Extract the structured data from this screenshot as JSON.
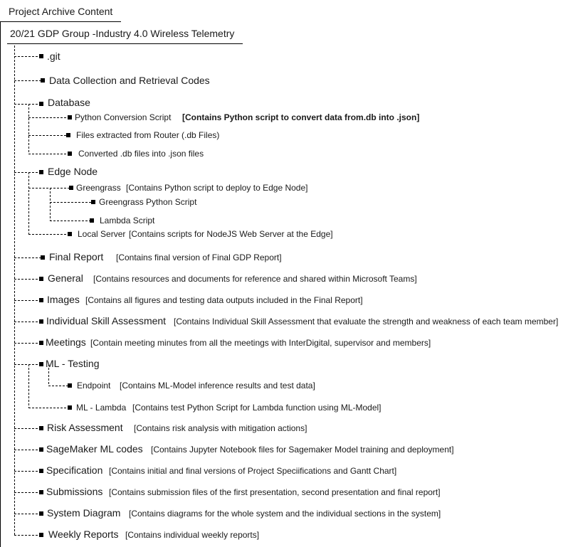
{
  "header": {
    "archive_title": "Project Archive Content",
    "group_title": "20/21 GDP Group  -Industry 4.0 Wireless Telemetry"
  },
  "tree": {
    "git": {
      "label": ".git"
    },
    "data_collection": {
      "label": "Data Collection and Retrieval Codes"
    },
    "database": {
      "label": "Database",
      "python_conversion": {
        "label": "Python Conversion Script",
        "desc": "[Contains Python script to convert  data from.db into .json]"
      },
      "files_extracted": {
        "label": "Files extracted from Router (.db Files)"
      },
      "converted_files": {
        "label": "Converted .db files into .json files"
      }
    },
    "edge_node": {
      "label": "Edge Node",
      "greengrass": {
        "label": "Greengrass",
        "desc": "[Contains Python script to deploy to Edge Node]"
      },
      "greengrass_python": {
        "label": "Greengrass Python Script"
      },
      "lambda_script": {
        "label": "Lambda Script"
      },
      "local_server": {
        "label": "Local Server",
        "desc": "[Contains scripts for NodeJS Web Server at the Edge]"
      }
    },
    "final_report": {
      "label": "Final Report",
      "desc": "[Contains final version of Final GDP Report]"
    },
    "general": {
      "label": "General",
      "desc": "[Contains resources and documents for reference and shared within Microsoft Teams]"
    },
    "images": {
      "label": "Images",
      "desc": "[Contains all figures and testing data outputs included in the Final Report]"
    },
    "skill_assessment": {
      "label": "Individual Skill Assessment",
      "desc": "[Contains Individual Skill Assessment that evaluate the strength and weakness of each team member]"
    },
    "meetings": {
      "label": "Meetings",
      "desc": "[Contain meeting minutes from all the meetings with InterDigital, supervisor and members]"
    },
    "ml_testing": {
      "label": "ML - Testing",
      "endpoint": {
        "label": "Endpoint",
        "desc": "[Contains ML-Model inference results and test data]"
      },
      "ml_lambda": {
        "label": "ML - Lambda",
        "desc": "[Contains test Python Script for Lambda function using ML-Model]"
      }
    },
    "risk_assessment": {
      "label": "Risk Assessment",
      "desc": "[Contains risk analysis with mitigation actions]"
    },
    "sagemaker": {
      "label": "SageMaker ML codes",
      "desc": "[Contains Jupyter Notebook files for Sagemaker Model training and deployment]"
    },
    "specification": {
      "label": "Specification",
      "desc": "[Contains initial and final versions of Project Speciifications and Gantt Chart]"
    },
    "submissions": {
      "label": "Submissions",
      "desc": "[Contains submission files of the first presentation, second presentation and final report]"
    },
    "system_diagram": {
      "label": "System Diagram",
      "desc": "[Contains diagrams for the whole system and the individual sections in the system]"
    },
    "weekly_reports": {
      "label": "Weekly Reports",
      "desc": "[Contains individual weekly reports]"
    }
  },
  "style": {
    "line_color": "#000000",
    "text_color": "#1a1a1a"
  }
}
